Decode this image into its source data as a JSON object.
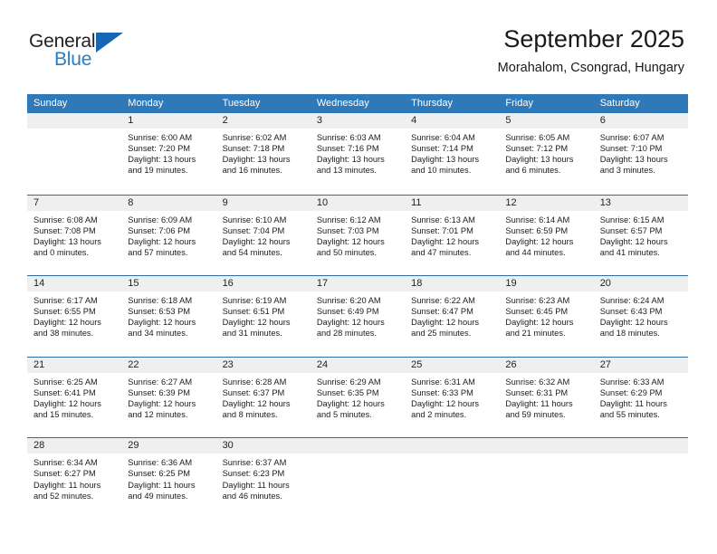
{
  "logo": {
    "primary_text": "General",
    "secondary_text": "Blue",
    "primary_color": "#231f20",
    "secondary_color": "#2b7cc1",
    "triangle_color": "#1668b3"
  },
  "header": {
    "title": "September 2025",
    "subtitle": "Morahalom, Csongrad, Hungary"
  },
  "colors": {
    "header_bar": "#3079b8",
    "day_number_band": "#efefef",
    "week_divider": "#2e6da4"
  },
  "weekdays": [
    "Sunday",
    "Monday",
    "Tuesday",
    "Wednesday",
    "Thursday",
    "Friday",
    "Saturday"
  ],
  "weeks": [
    [
      {
        "day": "",
        "sunrise": "",
        "sunset": "",
        "daylight_line1": "",
        "daylight_line2": ""
      },
      {
        "day": "1",
        "sunrise": "Sunrise: 6:00 AM",
        "sunset": "Sunset: 7:20 PM",
        "daylight_line1": "Daylight: 13 hours",
        "daylight_line2": "and 19 minutes."
      },
      {
        "day": "2",
        "sunrise": "Sunrise: 6:02 AM",
        "sunset": "Sunset: 7:18 PM",
        "daylight_line1": "Daylight: 13 hours",
        "daylight_line2": "and 16 minutes."
      },
      {
        "day": "3",
        "sunrise": "Sunrise: 6:03 AM",
        "sunset": "Sunset: 7:16 PM",
        "daylight_line1": "Daylight: 13 hours",
        "daylight_line2": "and 13 minutes."
      },
      {
        "day": "4",
        "sunrise": "Sunrise: 6:04 AM",
        "sunset": "Sunset: 7:14 PM",
        "daylight_line1": "Daylight: 13 hours",
        "daylight_line2": "and 10 minutes."
      },
      {
        "day": "5",
        "sunrise": "Sunrise: 6:05 AM",
        "sunset": "Sunset: 7:12 PM",
        "daylight_line1": "Daylight: 13 hours",
        "daylight_line2": "and 6 minutes."
      },
      {
        "day": "6",
        "sunrise": "Sunrise: 6:07 AM",
        "sunset": "Sunset: 7:10 PM",
        "daylight_line1": "Daylight: 13 hours",
        "daylight_line2": "and 3 minutes."
      }
    ],
    [
      {
        "day": "7",
        "sunrise": "Sunrise: 6:08 AM",
        "sunset": "Sunset: 7:08 PM",
        "daylight_line1": "Daylight: 13 hours",
        "daylight_line2": "and 0 minutes."
      },
      {
        "day": "8",
        "sunrise": "Sunrise: 6:09 AM",
        "sunset": "Sunset: 7:06 PM",
        "daylight_line1": "Daylight: 12 hours",
        "daylight_line2": "and 57 minutes."
      },
      {
        "day": "9",
        "sunrise": "Sunrise: 6:10 AM",
        "sunset": "Sunset: 7:04 PM",
        "daylight_line1": "Daylight: 12 hours",
        "daylight_line2": "and 54 minutes."
      },
      {
        "day": "10",
        "sunrise": "Sunrise: 6:12 AM",
        "sunset": "Sunset: 7:03 PM",
        "daylight_line1": "Daylight: 12 hours",
        "daylight_line2": "and 50 minutes."
      },
      {
        "day": "11",
        "sunrise": "Sunrise: 6:13 AM",
        "sunset": "Sunset: 7:01 PM",
        "daylight_line1": "Daylight: 12 hours",
        "daylight_line2": "and 47 minutes."
      },
      {
        "day": "12",
        "sunrise": "Sunrise: 6:14 AM",
        "sunset": "Sunset: 6:59 PM",
        "daylight_line1": "Daylight: 12 hours",
        "daylight_line2": "and 44 minutes."
      },
      {
        "day": "13",
        "sunrise": "Sunrise: 6:15 AM",
        "sunset": "Sunset: 6:57 PM",
        "daylight_line1": "Daylight: 12 hours",
        "daylight_line2": "and 41 minutes."
      }
    ],
    [
      {
        "day": "14",
        "sunrise": "Sunrise: 6:17 AM",
        "sunset": "Sunset: 6:55 PM",
        "daylight_line1": "Daylight: 12 hours",
        "daylight_line2": "and 38 minutes."
      },
      {
        "day": "15",
        "sunrise": "Sunrise: 6:18 AM",
        "sunset": "Sunset: 6:53 PM",
        "daylight_line1": "Daylight: 12 hours",
        "daylight_line2": "and 34 minutes."
      },
      {
        "day": "16",
        "sunrise": "Sunrise: 6:19 AM",
        "sunset": "Sunset: 6:51 PM",
        "daylight_line1": "Daylight: 12 hours",
        "daylight_line2": "and 31 minutes."
      },
      {
        "day": "17",
        "sunrise": "Sunrise: 6:20 AM",
        "sunset": "Sunset: 6:49 PM",
        "daylight_line1": "Daylight: 12 hours",
        "daylight_line2": "and 28 minutes."
      },
      {
        "day": "18",
        "sunrise": "Sunrise: 6:22 AM",
        "sunset": "Sunset: 6:47 PM",
        "daylight_line1": "Daylight: 12 hours",
        "daylight_line2": "and 25 minutes."
      },
      {
        "day": "19",
        "sunrise": "Sunrise: 6:23 AM",
        "sunset": "Sunset: 6:45 PM",
        "daylight_line1": "Daylight: 12 hours",
        "daylight_line2": "and 21 minutes."
      },
      {
        "day": "20",
        "sunrise": "Sunrise: 6:24 AM",
        "sunset": "Sunset: 6:43 PM",
        "daylight_line1": "Daylight: 12 hours",
        "daylight_line2": "and 18 minutes."
      }
    ],
    [
      {
        "day": "21",
        "sunrise": "Sunrise: 6:25 AM",
        "sunset": "Sunset: 6:41 PM",
        "daylight_line1": "Daylight: 12 hours",
        "daylight_line2": "and 15 minutes."
      },
      {
        "day": "22",
        "sunrise": "Sunrise: 6:27 AM",
        "sunset": "Sunset: 6:39 PM",
        "daylight_line1": "Daylight: 12 hours",
        "daylight_line2": "and 12 minutes."
      },
      {
        "day": "23",
        "sunrise": "Sunrise: 6:28 AM",
        "sunset": "Sunset: 6:37 PM",
        "daylight_line1": "Daylight: 12 hours",
        "daylight_line2": "and 8 minutes."
      },
      {
        "day": "24",
        "sunrise": "Sunrise: 6:29 AM",
        "sunset": "Sunset: 6:35 PM",
        "daylight_line1": "Daylight: 12 hours",
        "daylight_line2": "and 5 minutes."
      },
      {
        "day": "25",
        "sunrise": "Sunrise: 6:31 AM",
        "sunset": "Sunset: 6:33 PM",
        "daylight_line1": "Daylight: 12 hours",
        "daylight_line2": "and 2 minutes."
      },
      {
        "day": "26",
        "sunrise": "Sunrise: 6:32 AM",
        "sunset": "Sunset: 6:31 PM",
        "daylight_line1": "Daylight: 11 hours",
        "daylight_line2": "and 59 minutes."
      },
      {
        "day": "27",
        "sunrise": "Sunrise: 6:33 AM",
        "sunset": "Sunset: 6:29 PM",
        "daylight_line1": "Daylight: 11 hours",
        "daylight_line2": "and 55 minutes."
      }
    ],
    [
      {
        "day": "28",
        "sunrise": "Sunrise: 6:34 AM",
        "sunset": "Sunset: 6:27 PM",
        "daylight_line1": "Daylight: 11 hours",
        "daylight_line2": "and 52 minutes."
      },
      {
        "day": "29",
        "sunrise": "Sunrise: 6:36 AM",
        "sunset": "Sunset: 6:25 PM",
        "daylight_line1": "Daylight: 11 hours",
        "daylight_line2": "and 49 minutes."
      },
      {
        "day": "30",
        "sunrise": "Sunrise: 6:37 AM",
        "sunset": "Sunset: 6:23 PM",
        "daylight_line1": "Daylight: 11 hours",
        "daylight_line2": "and 46 minutes."
      },
      {
        "day": "",
        "sunrise": "",
        "sunset": "",
        "daylight_line1": "",
        "daylight_line2": ""
      },
      {
        "day": "",
        "sunrise": "",
        "sunset": "",
        "daylight_line1": "",
        "daylight_line2": ""
      },
      {
        "day": "",
        "sunrise": "",
        "sunset": "",
        "daylight_line1": "",
        "daylight_line2": ""
      },
      {
        "day": "",
        "sunrise": "",
        "sunset": "",
        "daylight_line1": "",
        "daylight_line2": ""
      }
    ]
  ]
}
